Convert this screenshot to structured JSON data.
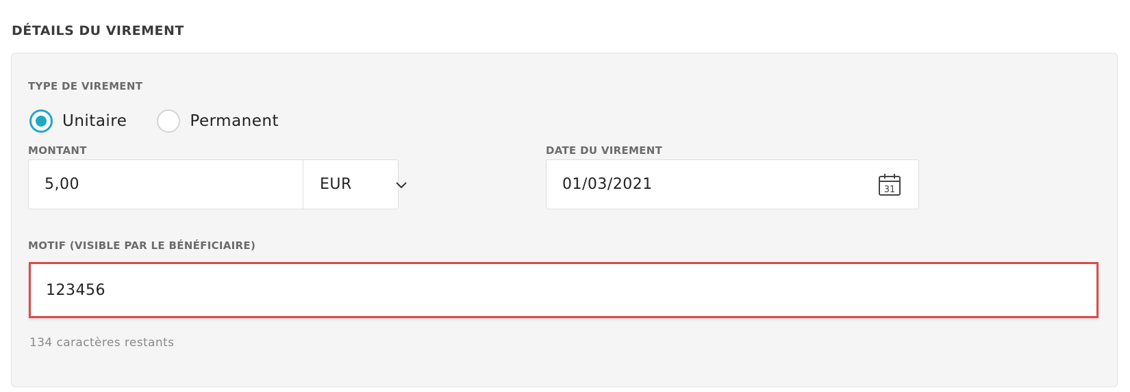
{
  "section": {
    "title": "DÉTAILS DU VIREMENT"
  },
  "transfer_type": {
    "label": "TYPE DE VIREMENT",
    "options": [
      {
        "label": "Unitaire",
        "checked": true
      },
      {
        "label": "Permanent",
        "checked": false
      }
    ]
  },
  "amount": {
    "label": "MONTANT",
    "value": "5,00",
    "currency": "EUR"
  },
  "date": {
    "label": "DATE DU VIREMENT",
    "value": "01/03/2021",
    "calendar_day": "31"
  },
  "motif": {
    "label": "MOTIF (VISIBLE PAR LE BÉNÉFICIAIRE)",
    "value": "123456",
    "remaining": "134 caractères restants"
  },
  "colors": {
    "accent": "#1ea8c6",
    "error_border": "#e04848",
    "panel_bg": "#f5f5f5"
  },
  "icons": {
    "currency_dropdown": "chevron-down-icon",
    "date_picker": "calendar-icon"
  }
}
